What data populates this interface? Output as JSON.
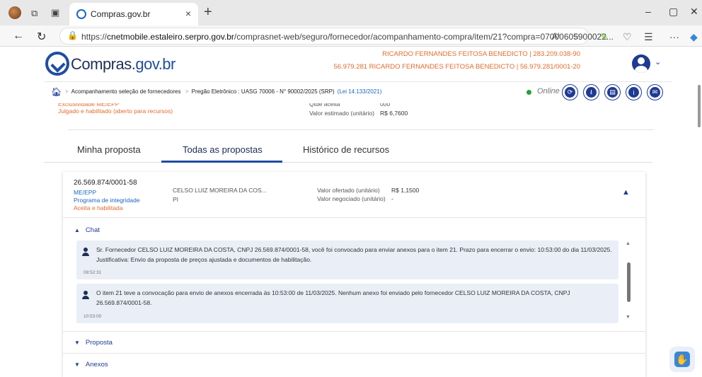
{
  "browser": {
    "tab_title": "Compras.gov.br",
    "tab_close": "×",
    "new_tab": "+",
    "url_prefix": "https://",
    "url_domain": "cnetmobile.estaleiro.serpro.gov.br",
    "url_path": "/comprasnet-web/seguro/fornecedor/acompanhamento-compra/item/21?compra=07000605900022...",
    "window_min": "–",
    "window_restore": "▢",
    "window_close": "✕"
  },
  "header": {
    "logo_text_main": "Compras.",
    "logo_text_gov": "gov.br",
    "user_line_1": "RICARDO FERNANDES FEITOSA BENEDICTO | 283.209.038-90",
    "user_line_2": "56.979.281 RICARDO FERNANDES FEITOSA BENEDICTO | 56.979.281/0001-20"
  },
  "breadcrumb": {
    "item_1": "Acompanhamento seleção de fornecedores",
    "item_2": "Pregão Eletrônico : UASG 70006 - N° 90002/2025 (SRP)",
    "law": "(Lei 14.133/2021)",
    "status": "Online"
  },
  "summary": {
    "partial_top": "Exclusividade ME/EPP",
    "status_text": "Julgado e habilitado (aberto para recursos)",
    "qty_label": "Qtde aceita",
    "qty_value": "000",
    "estimated_label": "Valor estimado (unitário)",
    "estimated_value": "R$ 6,7600"
  },
  "tabs": [
    "Minha proposta",
    "Todas as propostas",
    "Histórico de recursos"
  ],
  "proposal": {
    "cnpj": "26.569.874/0001-58",
    "size": "ME/EPP",
    "integrity": "Programa de integridade",
    "status": "Aceita e habilitada",
    "supplier_name": "CELSO LUIZ MOREIRA DA COS...",
    "supplier_state": "PI",
    "offered_label": "Valor ofertado (unitário)",
    "offered_value": "R$ 1,1500",
    "negotiated_label": "Valor negociado (unitário)",
    "negotiated_value": "-"
  },
  "chat": {
    "title": "Chat",
    "messages": [
      {
        "text": "Sr. Fornecedor CELSO LUIZ MOREIRA DA COSTA, CNPJ 26.569.874/0001-58, você foi convocado para enviar anexos para o item 21. Prazo para encerrar o envio: 10:53:00 do dia 11/03/2025. Justificativa: Envio da proposta de preços ajustada e documentos de habilitação.",
        "time": "08:52:31"
      },
      {
        "text": "O item 21 teve a convocação para envio de anexos encerrada às 10:53:00 de 11/03/2025. Nenhum anexo foi enviado pelo fornecedor CELSO LUIZ MOREIRA DA COSTA, CNPJ 26.569.874/0001-58.",
        "time": "10:53:00"
      }
    ]
  },
  "sections": {
    "proposta": "Proposta",
    "anexos": "Anexos"
  },
  "colors": {
    "brand_blue": "#1f4da3",
    "accent_orange": "#e46b2f",
    "online_green": "#21a336"
  }
}
